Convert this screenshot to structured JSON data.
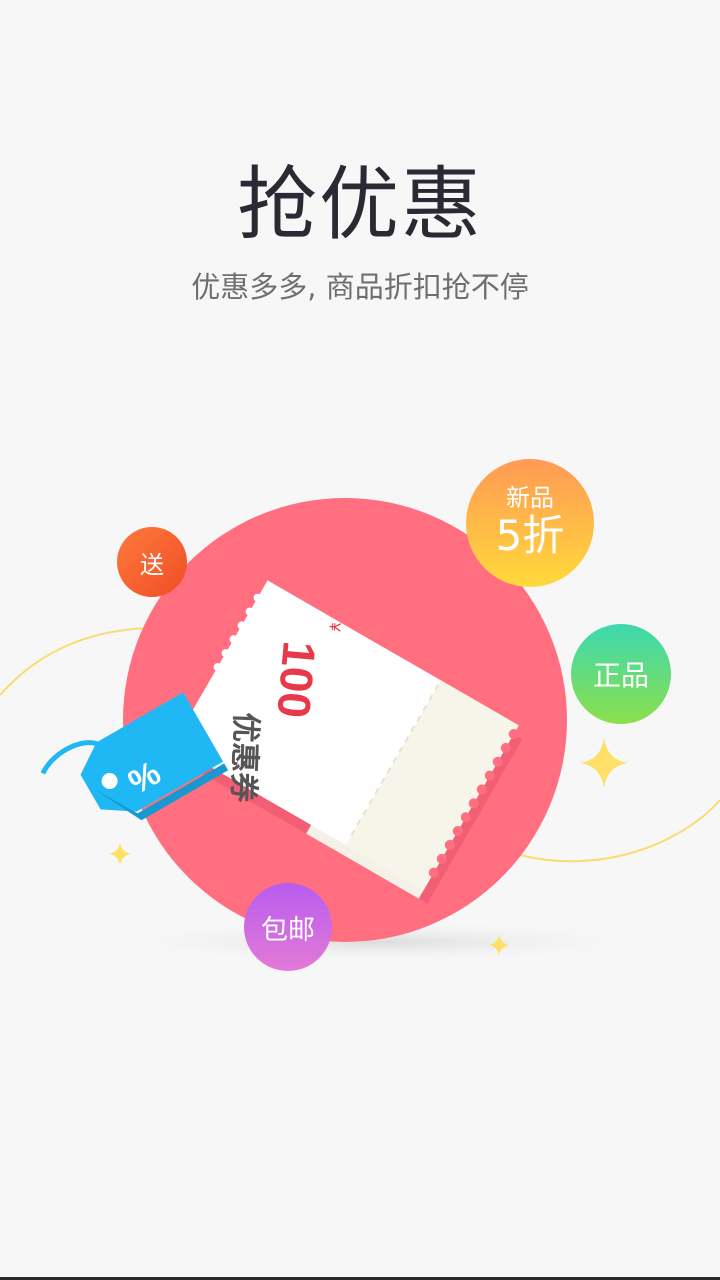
{
  "header": {
    "title": "抢优惠",
    "subtitle": "优惠多多, 商品折扣抢不停"
  },
  "coupon": {
    "currency": "¥",
    "amount": "100",
    "label": "优惠券"
  },
  "tag": {
    "symbol": "%"
  },
  "badges": {
    "song": "送",
    "xinpin_line1": "新品",
    "xinpin_line2": "5折",
    "zhengpin": "正品",
    "baoyou": "包邮"
  },
  "colors": {
    "circle": "#ff6f80",
    "tag": "#1fb8f5",
    "coupon_red": "#e8394a"
  }
}
